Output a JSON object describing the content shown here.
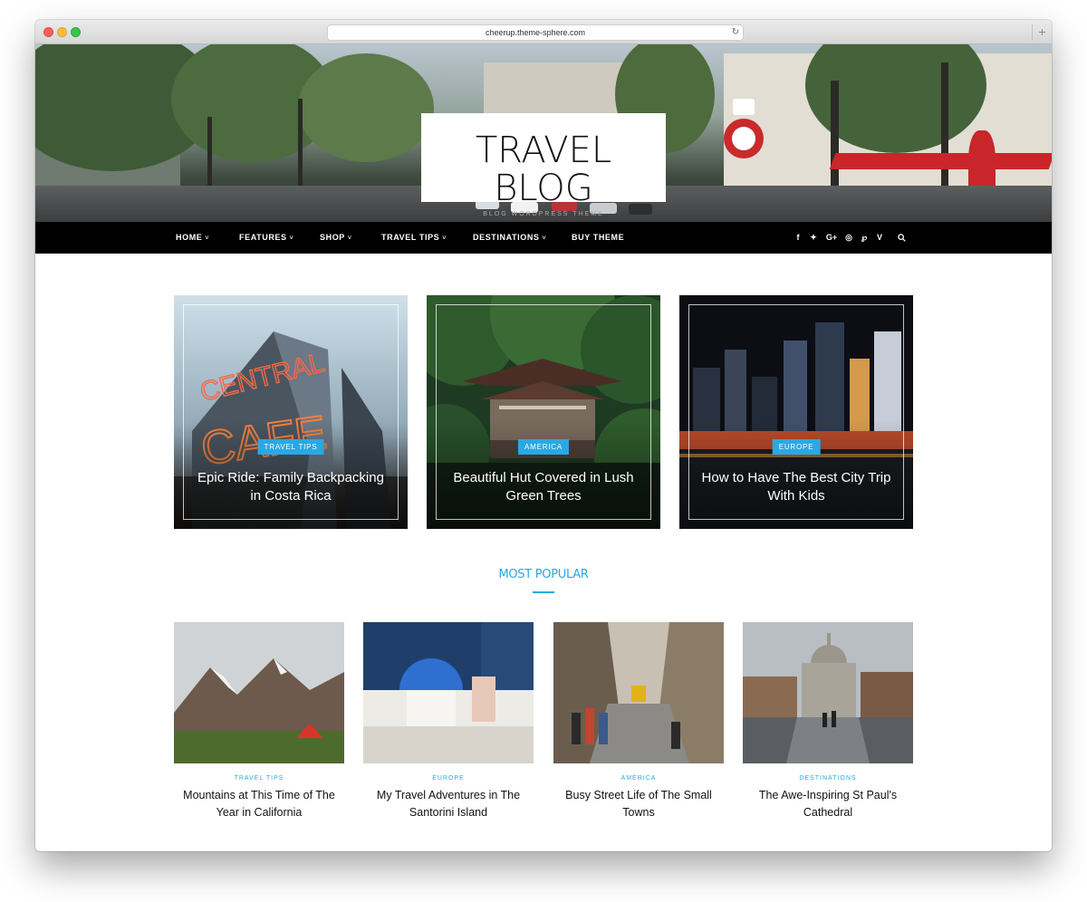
{
  "browser": {
    "url": "cheerup.theme-sphere.com",
    "reload_icon": "reload-icon",
    "newtab_icon": "plus-icon"
  },
  "header": {
    "logo_title": "TRAVEL BLOG",
    "logo_subtitle": "BLOG WORDPRESS THEME"
  },
  "nav": {
    "items": [
      {
        "label": "HOME",
        "has_caret": true
      },
      {
        "label": "FEATURES",
        "has_caret": true
      },
      {
        "label": "SHOP",
        "has_caret": true
      },
      {
        "label": "TRAVEL TIPS",
        "has_caret": true
      },
      {
        "label": "DESTINATIONS",
        "has_caret": true
      },
      {
        "label": "BUY THEME",
        "has_caret": false
      }
    ],
    "social": [
      {
        "icon": "facebook-icon",
        "glyph": "f"
      },
      {
        "icon": "twitter-icon",
        "glyph": "✦"
      },
      {
        "icon": "google-plus-icon",
        "glyph": "G+"
      },
      {
        "icon": "instagram-icon",
        "glyph": "◎"
      },
      {
        "icon": "pinterest-icon",
        "glyph": "℘"
      },
      {
        "icon": "vimeo-icon",
        "glyph": "V"
      }
    ],
    "search_icon": "search-icon",
    "caret_glyph": "˅"
  },
  "featured": [
    {
      "category": "TRAVEL TIPS",
      "title": "Epic Ride: Family Backpacking in Costa Rica"
    },
    {
      "category": "AMERICA",
      "title": "Beautiful Hut Covered in Lush Green Trees"
    },
    {
      "category": "EUROPE",
      "title": "How to Have The Best City Trip With Kids"
    }
  ],
  "most_popular": {
    "heading": "MOST POPULAR",
    "posts": [
      {
        "category": "TRAVEL TIPS",
        "title": "Mountains at This Time of The Year in California"
      },
      {
        "category": "EUROPE",
        "title": "My Travel Adventures in The Santorini Island"
      },
      {
        "category": "AMERICA",
        "title": "Busy Street Life of The Small Towns"
      },
      {
        "category": "DESTINATIONS",
        "title": "The Awe-Inspiring St Paul's Cathedral"
      }
    ]
  },
  "colors": {
    "accent": "#2aa8e3",
    "nav_bg": "#000000"
  }
}
